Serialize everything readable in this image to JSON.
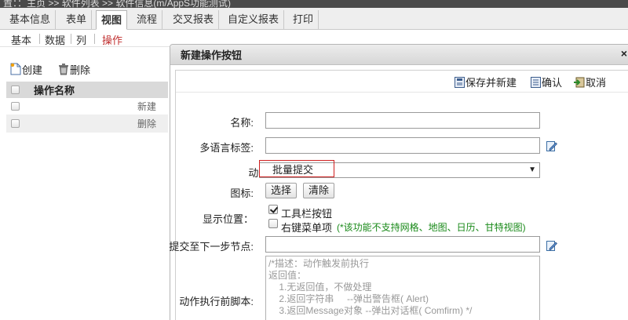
{
  "breadcrumb": "置：：主页 >> 软件列表 >> 软件信息(m/AppS功能测试)",
  "tabs": [
    "基本信息",
    "表单",
    "视图",
    "流程",
    "交叉报表",
    "自定义报表",
    "打印"
  ],
  "active_tab": "视图",
  "subtabs": [
    "基本",
    "数据",
    "列",
    "操作"
  ],
  "active_subtab": "操作",
  "left_toolbar": {
    "create": "创建",
    "delete": "删除"
  },
  "left_grid": {
    "header": "操作名称",
    "rows": [
      "新建",
      "删除"
    ]
  },
  "dialog": {
    "title": "新建操作按钮",
    "close": "×",
    "toolbar": {
      "save_new": "保存并新建",
      "confirm": "确认",
      "cancel": "取消"
    },
    "fields": {
      "name_label": "名称:",
      "name_value": "",
      "i18n_label": "多语言标签:",
      "i18n_value": "",
      "action_label": "动作:",
      "action_value": "批量提交",
      "icon_label": "图标:",
      "icon_choose": "选择",
      "icon_clear": "清除",
      "display_label": "显示位置：",
      "toolbar_button": "工具栏按钮",
      "toolbar_button_checked": true,
      "context_menu": "右键菜单项",
      "context_menu_checked": false,
      "context_menu_note": "(*该功能不支持网格、地图、日历、甘特视图)",
      "next_node_label": "提交至下一步节点:",
      "next_node_value": "",
      "pre_script_label": "动作执行前脚本:",
      "pre_script_value": "/*描述：动作触发前执行\n返回值：\n    1.无返回值，不做处理\n    2.返回字符串     --弹出警告框( Alert)\n    3.返回Message对象 --弹出对话框( Comfirm) */"
    }
  },
  "colors": {
    "highlight": "#d02020",
    "note": "#1a8a1a",
    "active_subtab": "#c03030"
  }
}
